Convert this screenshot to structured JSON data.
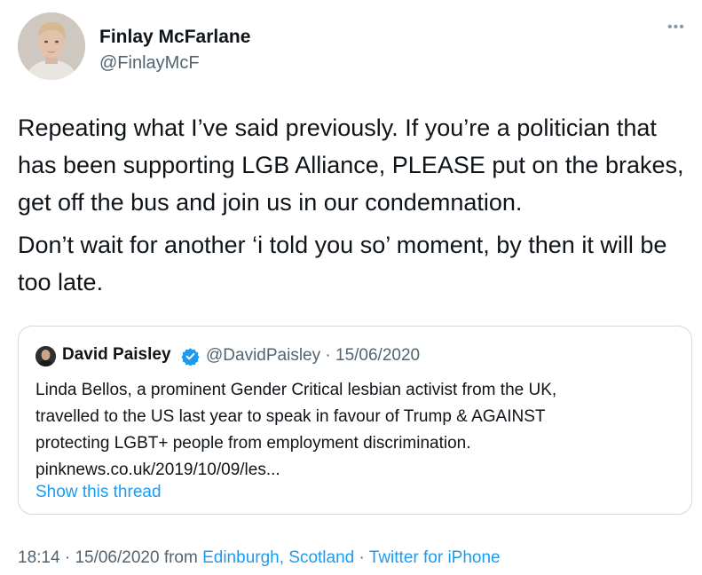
{
  "author": {
    "display_name": "Finlay McFarlane",
    "handle": "@FinlayMcF",
    "more_icon": "more-horizontal-icon"
  },
  "tweet": {
    "paragraphs": [
      "Repeating what I’ve said previously. If you’re a politician that has been supporting LGB Alliance, PLEASE put on the brakes, get off the bus and join us in our condemnation.",
      "Don’t wait for another ‘i told you so’ moment, by then it will be too late."
    ]
  },
  "quoted_tweet": {
    "author_name": "David Paisley",
    "verified_icon": "verified-badge-icon",
    "handle": "@DavidPaisley",
    "separator": "·",
    "date": "15/06/2020",
    "lines": [
      "Linda Bellos, a prominent Gender Critical lesbian activist from the UK,",
      "travelled to the US last year to speak in favour of Trump & AGAINST",
      "protecting LGBT+ people from employment discrimination.",
      "pinknews.co.uk/2019/10/09/les..."
    ],
    "show_thread": "Show this thread"
  },
  "footer": {
    "time": "18:14",
    "sep1": "·",
    "date": "15/06/2020",
    "from": "from",
    "location": "Edinburgh, Scotland",
    "sep2": "·",
    "source": "Twitter for iPhone"
  },
  "colors": {
    "link": "#1d9bf0",
    "secondary_text": "#536471",
    "border": "#cfd9de"
  }
}
